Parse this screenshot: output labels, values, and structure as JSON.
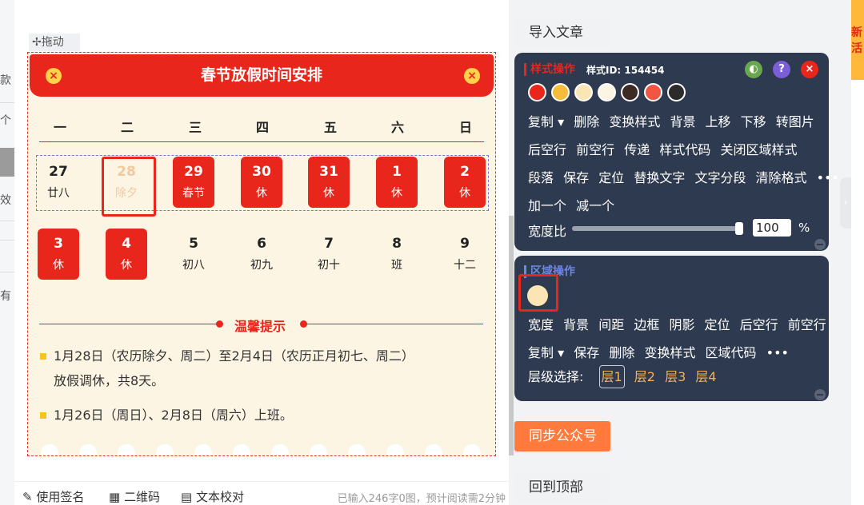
{
  "left_stub": {
    "t1": "款",
    "t2": "个",
    "t3": "效",
    "t4": "有"
  },
  "editor": {
    "drag_label": "✢拖动",
    "card": {
      "title": "春节放假时间安排",
      "weekdays": [
        "一",
        "二",
        "三",
        "四",
        "五",
        "六",
        "日"
      ],
      "row1": [
        {
          "n": "27",
          "l": "廿八",
          "style": "plain"
        },
        {
          "n": "28",
          "l": "除夕",
          "style": "faded"
        },
        {
          "n": "29",
          "l": "春节",
          "style": "red"
        },
        {
          "n": "30",
          "l": "休",
          "style": "red"
        },
        {
          "n": "31",
          "l": "休",
          "style": "red"
        },
        {
          "n": "1",
          "l": "休",
          "style": "red"
        },
        {
          "n": "2",
          "l": "休",
          "style": "red"
        }
      ],
      "row2": [
        {
          "n": "3",
          "l": "休",
          "style": "red"
        },
        {
          "n": "4",
          "l": "休",
          "style": "red"
        },
        {
          "n": "5",
          "l": "初八",
          "style": "plain"
        },
        {
          "n": "6",
          "l": "初九",
          "style": "plain"
        },
        {
          "n": "7",
          "l": "初十",
          "style": "plain"
        },
        {
          "n": "8",
          "l": "班",
          "style": "plain"
        },
        {
          "n": "9",
          "l": "十二",
          "style": "plain"
        }
      ],
      "tip_title": "温馨提示",
      "para1_line1": "1月28日（农历除夕、周二）至2月4日（农历正月初七、周二）",
      "para1_line2": "放假调休，共8天。",
      "para2": "1月26日（周日）、2月8日（周六）上班。"
    },
    "bottom_bar": {
      "signature": "使用签名",
      "qrcode": "二维码",
      "proofread": "文本校对",
      "info": "已输入246字0图，预计阅读需2分钟"
    }
  },
  "right_buttons": {
    "import": "导入文章",
    "sync": "同步公众号",
    "top": "回到顶部"
  },
  "style_panel": {
    "title": "样式操作",
    "style_id": "样式ID: 154454",
    "colors": [
      "#e8261b",
      "#f7bd3a",
      "#fce5b4",
      "#fdf5e3",
      "#3d2a25",
      "#f25544",
      "#2b2b2b"
    ],
    "row1": [
      "复制 ▾",
      "删除",
      "变换样式",
      "背景",
      "上移",
      "下移",
      "转图片"
    ],
    "row2": [
      "后空行",
      "前空行",
      "传递",
      "样式代码",
      "关闭区域样式"
    ],
    "row3": [
      "段落",
      "保存",
      "定位",
      "替换文字",
      "文字分段",
      "清除格式",
      "•••"
    ],
    "row4": [
      "加一个",
      "减一个"
    ],
    "width_label": "宽度比",
    "width_value": "100",
    "width_unit": "%"
  },
  "region_panel": {
    "title": "区域操作",
    "swatch_color": "#fce5b4",
    "row1": [
      "宽度",
      "背景",
      "间距",
      "边框",
      "阴影",
      "定位",
      "后空行",
      "前空行"
    ],
    "row2": [
      "复制 ▾",
      "保存",
      "删除",
      "变换样式",
      "区域代码",
      "•••"
    ],
    "layer_label": "层级选择:",
    "layers": [
      "层1",
      "层2",
      "层3",
      "层4"
    ]
  },
  "far_right": {
    "ad_text": "新活"
  }
}
